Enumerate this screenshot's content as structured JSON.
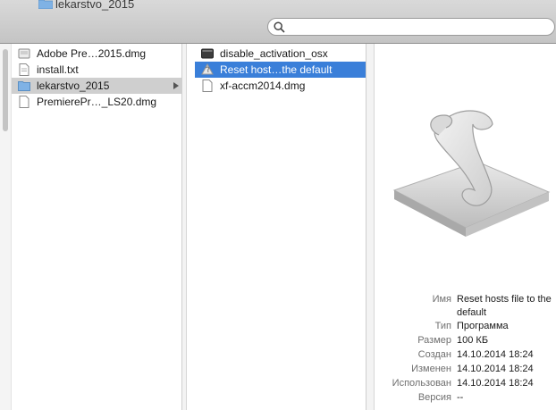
{
  "toolbar": {
    "folder_title": "lekarstvo_2015",
    "search_value": "",
    "search_icon": "magnifier"
  },
  "column1": {
    "items": [
      {
        "label": "Adobe Pre…2015.dmg",
        "icon": "disk-image-icon",
        "state": "normal"
      },
      {
        "label": "install.txt",
        "icon": "text-document-icon",
        "state": "normal"
      },
      {
        "label": "lekarstvo_2015",
        "icon": "folder-icon",
        "state": "selected-inactive",
        "has_children": true
      },
      {
        "label": "PremierePr…_LS20.dmg",
        "icon": "disk-image-icon",
        "state": "normal"
      }
    ]
  },
  "column2": {
    "items": [
      {
        "label": "disable_activation_osx",
        "icon": "executable-icon",
        "state": "normal"
      },
      {
        "label": "Reset host…the default",
        "icon": "script-app-icon",
        "state": "selected"
      },
      {
        "label": "xf-accm2014.dmg",
        "icon": "disk-image-icon",
        "state": "normal"
      }
    ]
  },
  "preview": {
    "icon": "applescript-scroll-icon",
    "info": [
      {
        "key": "Имя",
        "value": "Reset hosts file to the default"
      },
      {
        "key": "Тип",
        "value": "Программа"
      },
      {
        "key": "Размер",
        "value": "100 КБ"
      },
      {
        "key": "Создан",
        "value": "14.10.2014 18:24"
      },
      {
        "key": "Изменен",
        "value": "14.10.2014 18:24"
      },
      {
        "key": "Использован",
        "value": "14.10.2014 18:24"
      },
      {
        "key": "Версия",
        "value": "--"
      }
    ]
  },
  "colors": {
    "selection_blue": "#3a7fd9",
    "selection_gray": "#cfcfcf",
    "folder_blue": "#7fb2e5"
  }
}
